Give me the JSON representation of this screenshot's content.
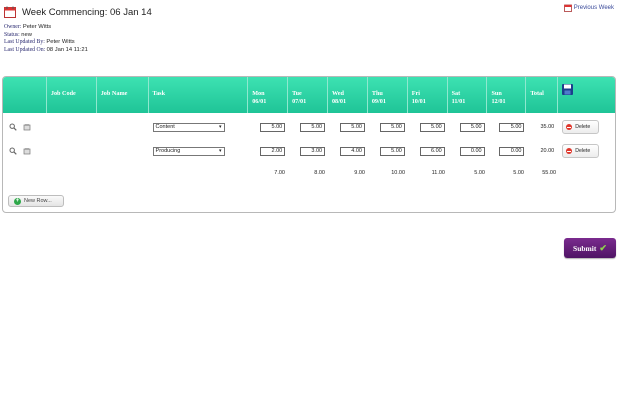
{
  "header": {
    "title": "Week Commencing: 06 Jan 14",
    "prev_week_label": "Previous Week"
  },
  "meta": [
    {
      "label": "Owner:",
      "value": "Peter Witts"
    },
    {
      "label": "Status:",
      "value": "new"
    },
    {
      "label": "Last Updated By:",
      "value": "Peter Witts"
    },
    {
      "label": "Last Updated On:",
      "value": "08 Jan 14 11:21"
    }
  ],
  "table": {
    "headers": {
      "job_code": "Job Code",
      "job_name": "Job Name",
      "task": "Task",
      "mon_day": "Mon",
      "mon_date": "06/01",
      "tue_day": "Tue",
      "tue_date": "07/01",
      "wed_day": "Wed",
      "wed_date": "08/01",
      "thu_day": "Thu",
      "thu_date": "09/01",
      "fri_day": "Fri",
      "fri_date": "10/01",
      "sat_day": "Sat",
      "sat_date": "11/01",
      "sun_day": "Sun",
      "sun_date": "12/01",
      "total": "Total"
    },
    "rows": [
      {
        "task": "Content",
        "mon": "5.00",
        "tue": "5.00",
        "wed": "5.00",
        "thu": "5.00",
        "fri": "5.00",
        "sat": "5.00",
        "sun": "5.00",
        "total": "35.00",
        "delete_label": "Delete"
      },
      {
        "task": "Producing",
        "mon": "2.00",
        "tue": "3.00",
        "wed": "4.00",
        "thu": "5.00",
        "fri": "6.00",
        "sat": "0.00",
        "sun": "0.00",
        "total": "20.00",
        "delete_label": "Delete"
      }
    ],
    "footer_totals": {
      "mon": "7.00",
      "tue": "8.00",
      "wed": "9.00",
      "thu": "10.00",
      "fri": "11.00",
      "sat": "5.00",
      "sun": "5.00",
      "total": "55.00"
    },
    "new_row_label": "New Row..."
  },
  "submit_label": "Submit",
  "colors": {
    "header_teal": "#1fc497",
    "submit_purple": "#5d1a74",
    "check_green": "#8fd14f",
    "delete_red": "#e0362b"
  },
  "icons": [
    "calendar-icon",
    "zoom-icon",
    "note-icon",
    "save-icon",
    "delete-icon",
    "plus-icon",
    "checkmark-icon"
  ]
}
